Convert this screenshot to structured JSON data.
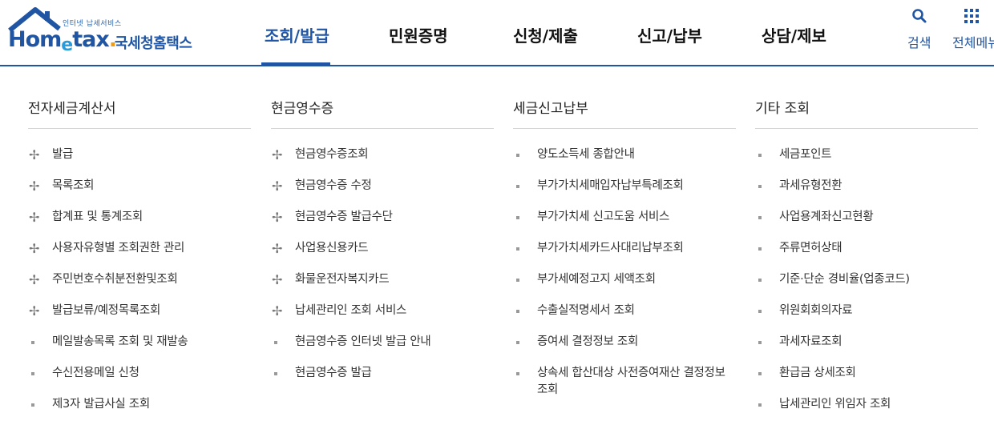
{
  "logo": {
    "small_text": "인터넷 납세서비스",
    "main_text_pre": "Hom",
    "main_text_e": "e",
    "main_text_post": "tax",
    "main_text_dot": ".",
    "korean_text": "국세청홈택스",
    "brand_color": "#1f55a3"
  },
  "gnb": {
    "items": [
      {
        "label": "조회/발급",
        "active": true
      },
      {
        "label": "민원증명"
      },
      {
        "label": "신청/제출"
      },
      {
        "label": "신고/납부"
      },
      {
        "label": "상담/제보"
      }
    ]
  },
  "util": {
    "search_label": "검색",
    "search_icon": "search-icon",
    "all_menu_label": "전체메뉴",
    "all_menu_icon": "grid-icon"
  },
  "columns": [
    {
      "title": "전자세금계산서",
      "items": [
        {
          "label": "발급",
          "marker": "plus"
        },
        {
          "label": "목록조회",
          "marker": "plus"
        },
        {
          "label": "합계표 및 통계조회",
          "marker": "plus"
        },
        {
          "label": "사용자유형별 조회권한 관리",
          "marker": "plus"
        },
        {
          "label": "주민번호수취분전환및조회",
          "marker": "plus"
        },
        {
          "label": "발급보류/예정목록조회",
          "marker": "plus"
        },
        {
          "label": "메일발송목록 조회 및 재발송",
          "marker": "square"
        },
        {
          "label": "수신전용메일 신청",
          "marker": "square"
        },
        {
          "label": "제3자 발급사실 조회",
          "marker": "square"
        }
      ]
    },
    {
      "title": "현금영수증",
      "items": [
        {
          "label": "현금영수증조회",
          "marker": "plus"
        },
        {
          "label": "현금영수증 수정",
          "marker": "plus"
        },
        {
          "label": "현금영수증 발급수단",
          "marker": "plus"
        },
        {
          "label": "사업용신용카드",
          "marker": "plus"
        },
        {
          "label": "화물운전자복지카드",
          "marker": "plus"
        },
        {
          "label": "납세관리인 조회 서비스",
          "marker": "plus"
        },
        {
          "label": "현금영수증 인터넷 발급 안내",
          "marker": "square"
        },
        {
          "label": "현금영수증 발급",
          "marker": "square"
        }
      ]
    },
    {
      "title": "세금신고납부",
      "items": [
        {
          "label": "양도소득세 종합안내",
          "marker": "square"
        },
        {
          "label": "부가가치세매입자납부특례조회",
          "marker": "square"
        },
        {
          "label": "부가가치세 신고도움 서비스",
          "marker": "square"
        },
        {
          "label": "부가가치세카드사대리납부조회",
          "marker": "square"
        },
        {
          "label": "부가세예정고지 세액조회",
          "marker": "square"
        },
        {
          "label": "수출실적명세서 조회",
          "marker": "square"
        },
        {
          "label": "증여세 결정정보 조회",
          "marker": "square"
        },
        {
          "label": "상속세 합산대상 사전증여재산 결정정보 조회",
          "marker": "square"
        }
      ]
    },
    {
      "title": "기타 조회",
      "items": [
        {
          "label": "세금포인트",
          "marker": "square"
        },
        {
          "label": "과세유형전환",
          "marker": "square"
        },
        {
          "label": "사업용계좌신고현황",
          "marker": "square"
        },
        {
          "label": "주류면허상태",
          "marker": "square"
        },
        {
          "label": "기준·단순 경비율(업종코드)",
          "marker": "square"
        },
        {
          "label": "위원회회의자료",
          "marker": "square"
        },
        {
          "label": "과세자료조회",
          "marker": "square"
        },
        {
          "label": "환급금 상세조회",
          "marker": "square"
        },
        {
          "label": "납세관리인 위임자 조회",
          "marker": "square"
        }
      ]
    }
  ]
}
